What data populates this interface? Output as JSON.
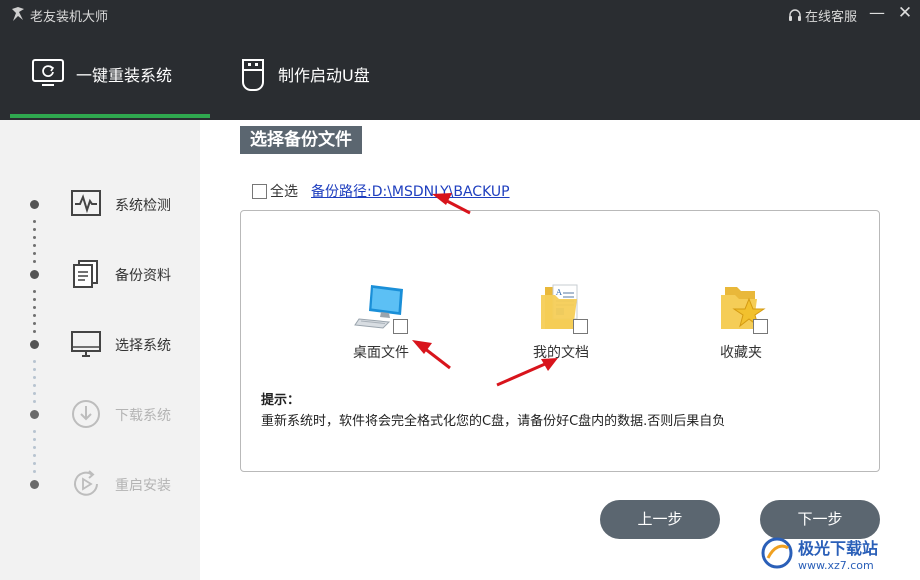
{
  "titlebar": {
    "title": "老友装机大师",
    "service": "在线客服",
    "minimize": "—",
    "close": "✕"
  },
  "nav": {
    "tabs": [
      {
        "label": "一键重装系统",
        "active": true
      },
      {
        "label": "制作启动U盘",
        "active": false
      }
    ],
    "accent": "#2fa84f"
  },
  "sidebar": {
    "steps": [
      {
        "label": "系统检测",
        "icon": "monitor-pulse-icon",
        "enabled": true
      },
      {
        "label": "备份资料",
        "icon": "documents-icon",
        "enabled": true
      },
      {
        "label": "选择系统",
        "icon": "monitor-icon",
        "enabled": true
      },
      {
        "label": "下载系统",
        "icon": "download-icon",
        "enabled": false
      },
      {
        "label": "重启安装",
        "icon": "restart-icon",
        "enabled": false
      }
    ]
  },
  "main": {
    "section_title": "选择备份文件",
    "select_all": "全选",
    "backup_path": "备份路径:D:\\MSDNLY\\BACKUP",
    "files": [
      {
        "label": "桌面文件",
        "icon": "desktop-computer-icon"
      },
      {
        "label": "我的文档",
        "icon": "documents-folder-icon"
      },
      {
        "label": "收藏夹",
        "icon": "favorites-folder-icon"
      }
    ],
    "tips_title": "提示：",
    "tips_text": "重新系统时，软件将会完全格式化您的C盘，请备份好C盘内的数据.否则后果自负",
    "prev_button": "上一步",
    "next_button": "下一步"
  },
  "watermark": {
    "main": "极光下载站",
    "sub": "www.xz7.com"
  },
  "colors": {
    "titlebar_bg": "#2a2d31",
    "sidebar_bg": "#f2f2f2",
    "button_bg": "#5b6670",
    "link": "#1f3fbf",
    "arrow": "#d8141c"
  }
}
